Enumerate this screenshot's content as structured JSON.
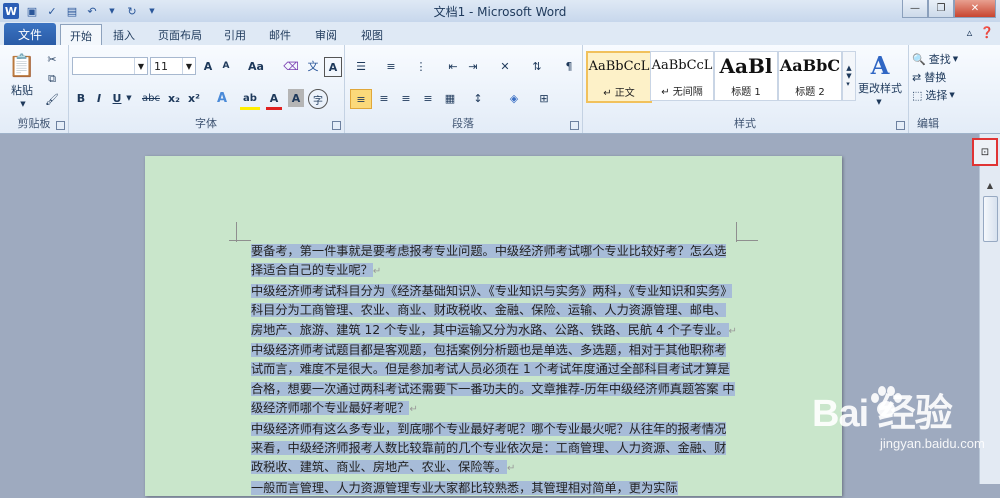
{
  "window": {
    "title": "文档1 - Microsoft Word"
  },
  "qat": {
    "word_icon": "W",
    "save_icon": "save-icon",
    "undo_icon": "undo-icon",
    "redo_icon": "redo-icon"
  },
  "tabs": {
    "file": "文件",
    "items": [
      "开始",
      "插入",
      "页面布局",
      "引用",
      "邮件",
      "审阅",
      "视图"
    ]
  },
  "clipboard": {
    "paste": "粘贴",
    "label": "剪贴板"
  },
  "font": {
    "name": "",
    "size": "11",
    "label": "字体",
    "bold": "B",
    "italic": "I",
    "underline": "U",
    "strike": "abc",
    "sub": "x₂",
    "sup": "x²",
    "grow": "A",
    "shrink": "A",
    "case": "Aa",
    "clear": "A",
    "font_color": "A",
    "highlight": "ab",
    "char_shade": "A",
    "enclose": "字"
  },
  "paragraph": {
    "label": "段落"
  },
  "styles": {
    "label": "样式",
    "items": [
      {
        "sample": "AaBbCcL",
        "name": "↵ 正文"
      },
      {
        "sample": "AaBbCcL",
        "name": "↵ 无间隔"
      },
      {
        "sample": "AaBl",
        "name": "标题 1"
      },
      {
        "sample": "AaBbC",
        "name": "标题 2"
      }
    ],
    "change": "更改样式"
  },
  "editing": {
    "label": "编辑",
    "find": "查找",
    "replace": "替换",
    "select": "选择"
  },
  "document": {
    "paragraphs": [
      "要备考，第一件事就是要考虑报考专业问题。中级经济师考试哪个专业比较好考？怎么选择适合自己的专业呢？",
      "中级经济师考试科目分为《经济基础知识》、《专业知识与实务》两科，《专业知识和实务》科目分为工商管理、农业、商业、财政税收、金融、保险、运输、人力资源管理、邮电、房地产、旅游、建筑 12 个专业，其中运输又分为水路、公路、铁路、民航 4 个子专业。",
      "中级经济师考试题目都是客观题，包括案例分析题也是单选、多选题，相对于其他职称考试而言，难度不是很大。但是参加考试人员必须在 1 个考试年度通过全部科目考试才算是合格，想要一次通过两科考试还需要下一番功夫的。文章推荐-历年中级经济师真题答案     中级经济师哪个专业最好考呢？",
      "中级经济师有这么多专业，到底哪个专业最好考呢？哪个专业最火呢？从往年的报考情况来看，中级经济师报考人数比较靠前的几个专业依次是：工商管理、人力资源、金融、财政税收、建筑、商业、房地产、农业、保险等。",
      "一般而言管理、人力资源管理专业大家都比较熟悉，其管理相对简单，更为实际"
    ]
  },
  "watermark": {
    "brand": "Bai  经验",
    "url": "jingyan.baidu.com"
  }
}
